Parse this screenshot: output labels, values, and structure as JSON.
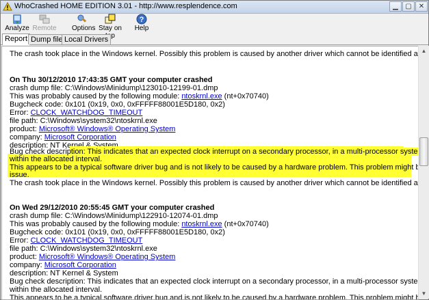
{
  "window": {
    "title": "WhoCrashed HOME EDITION 3.01 - http://www.resplendence.com"
  },
  "toolbar": {
    "analyze": "Analyze",
    "remote": "Remote",
    "options": "Options",
    "stay_on_top": "Stay on top",
    "help": "Help"
  },
  "tabs": [
    "Report",
    "Dump files",
    "Local Drivers"
  ],
  "report": {
    "kernel_line": "The crash took place in the Windows kernel. Possibly this problem is caused by another driver which cannot be identified at this time.",
    "crash1": {
      "heading": "On Thu 30/12/2010 17:43:35 GMT your computer crashed",
      "dump": "crash dump file: C:\\Windows\\Minidump\\123010-12199-01.dmp",
      "module_prefix": "This was probably caused by the following module: ",
      "module": "ntoskrnl.exe",
      "module_suffix": " (nt+0x70740)",
      "bugcheck": "Bugcheck code: 0x101 (0x19, 0x0, 0xFFFFF88001E5D180, 0x2)",
      "error_prefix": "Error: ",
      "error": "CLOCK_WATCHDOG_TIMEOUT",
      "filepath": "file path: C:\\Windows\\system32\\ntoskrnl.exe",
      "product_prefix": "product: ",
      "product": "Microsoft® Windows® Operating System",
      "company_prefix": "company: ",
      "company": "Microsoft Corporation",
      "description": "description: NT Kernel & System",
      "bugdesc_prefix": "Bug check description: ",
      "bugdesc_a": "This indicates that an expected clock interrupt on a secondary processor, in a multi-processor system, was not received",
      "bugdesc_b": "within the allocated interval.",
      "typical_a": "This appears to be a typical software driver bug and is not likely to be caused by a hardware problem. This problem might be caused by a thermal",
      "typical_b": "issue.",
      "kernel_line": "The crash took place in the Windows kernel. Possibly this problem is caused by another driver which cannot be identified at this time."
    },
    "crash2": {
      "heading": "On Wed 29/12/2010 20:55:45 GMT your computer crashed",
      "dump": "crash dump file: C:\\Windows\\Minidump\\122910-12074-01.dmp",
      "module_prefix": "This was probably caused by the following module: ",
      "module": "ntoskrnl.exe",
      "module_suffix": " (nt+0x70740)",
      "bugcheck": "Bugcheck code: 0x101 (0x19, 0x0, 0xFFFFF88001E5D180, 0x2)",
      "error_prefix": "Error: ",
      "error": "CLOCK_WATCHDOG_TIMEOUT",
      "filepath": "file path: C:\\Windows\\system32\\ntoskrnl.exe",
      "product_prefix": "product: ",
      "product": "Microsoft® Windows® Operating System",
      "company_prefix": "company: ",
      "company": "Microsoft Corporation",
      "description": "description: NT Kernel & System",
      "bugdesc": "Bug check description: This indicates that an expected clock interrupt on a secondary processor, in a multi-processor system, was not received",
      "bugdesc_b": "within the allocated interval.",
      "typical": "This appears to be a typical software driver bug and is not likely to be caused by a hardware problem. This problem might be caused by a thermal"
    }
  },
  "colors": {
    "highlight": "#ffff33",
    "link": "#0000cc"
  }
}
